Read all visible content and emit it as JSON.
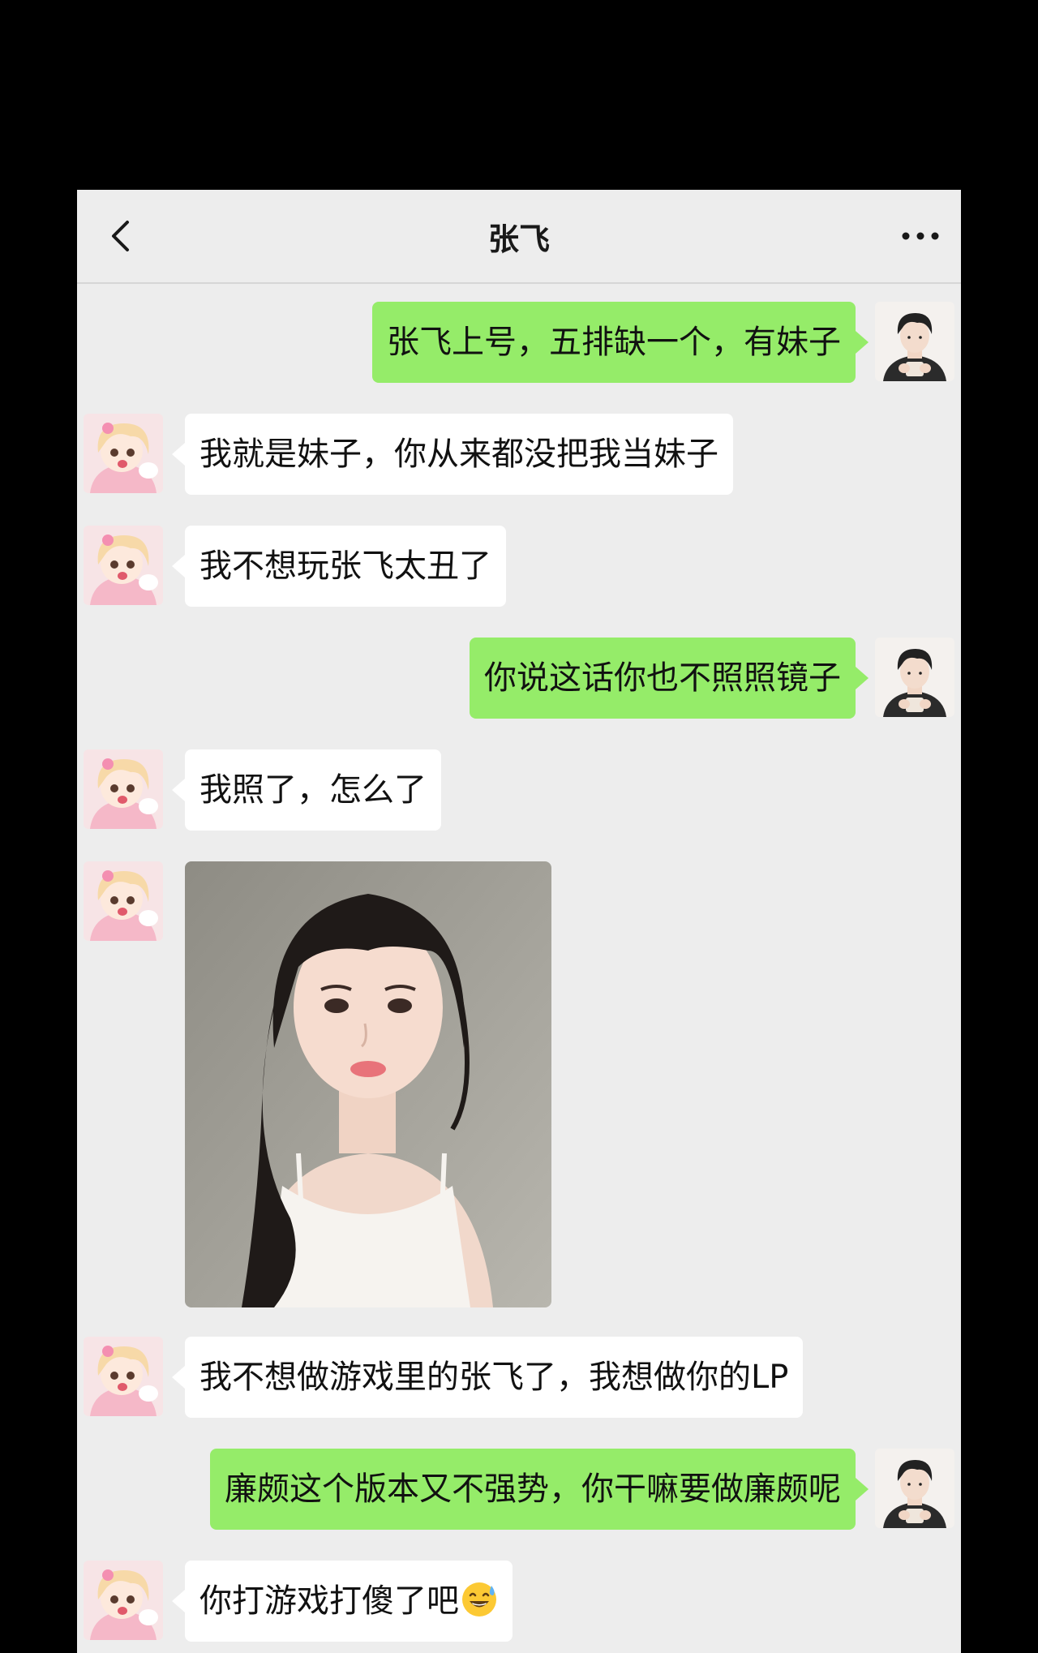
{
  "header": {
    "title": "张飞"
  },
  "icons": {
    "back": "chevron-left-icon",
    "more": "more-dots-icon"
  },
  "colors": {
    "sent_bubble": "#95ec69",
    "received_bubble": "#ffffff",
    "background": "#ededed"
  },
  "messages": [
    {
      "side": "right",
      "text": "张飞上号，五排缺一个，有妹子"
    },
    {
      "side": "left",
      "text": "我就是妹子，你从来都没把我当妹子"
    },
    {
      "side": "left",
      "text": "我不想玩张飞太丑了"
    },
    {
      "side": "right",
      "text": "你说这话你也不照照镜子"
    },
    {
      "side": "left",
      "text": "我照了，怎么了"
    },
    {
      "side": "left",
      "type": "image",
      "image": "portrait-photo"
    },
    {
      "side": "left",
      "text": "我不想做游戏里的张飞了，我想做你的LP"
    },
    {
      "side": "right",
      "text": "廉颇这个版本又不强势，你干嘛要做廉颇呢"
    },
    {
      "side": "left",
      "text": "你打游戏打傻了吧",
      "emoji": "sweat-smile-emoji"
    }
  ]
}
